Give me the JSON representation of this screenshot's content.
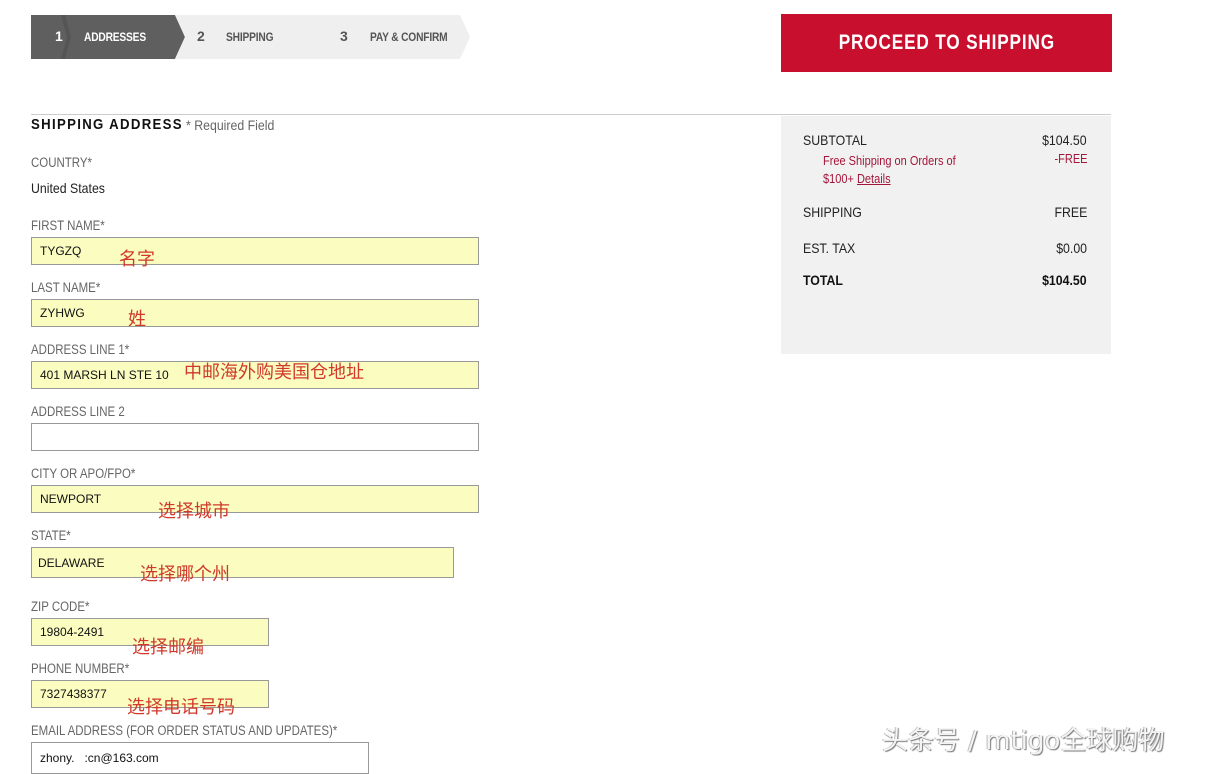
{
  "steps": [
    {
      "number": "1",
      "label": "ADDRESSES",
      "active": true
    },
    {
      "number": "2",
      "label": "SHIPPING",
      "active": false
    },
    {
      "number": "3",
      "label": "PAY & CONFIRM",
      "active": false
    }
  ],
  "proceed_button": {
    "label": "PROCEED TO SHIPPING"
  },
  "form": {
    "title": "SHIPPING ADDRESS",
    "required_note": "* Required Field",
    "country": {
      "label": "COUNTRY*",
      "value": "United States"
    },
    "first_name": {
      "label": "FIRST NAME*",
      "value": "TYGZQ",
      "annotation": "名字"
    },
    "last_name": {
      "label": "LAST NAME*",
      "value": "ZYHWG",
      "annotation": "姓"
    },
    "address1": {
      "label": "ADDRESS LINE 1*",
      "value": "401 MARSH LN STE 10",
      "annotation": "中邮海外购美国仓地址"
    },
    "address2": {
      "label": "ADDRESS LINE 2",
      "value": ""
    },
    "city": {
      "label": "CITY OR APO/FPO*",
      "value": "NEWPORT",
      "annotation": "选择城市"
    },
    "state": {
      "label": "STATE*",
      "value": "DELAWARE",
      "annotation": "选择哪个州"
    },
    "zip": {
      "label": "ZIP CODE*",
      "value": "19804-2491",
      "annotation": "选择邮编"
    },
    "phone": {
      "label": "PHONE NUMBER*",
      "value": "7327438377",
      "annotation": "选择电话号码"
    },
    "email": {
      "label": "EMAIL ADDRESS (FOR ORDER STATUS AND UPDATES)*",
      "value": "zhony.   :cn@163.com"
    }
  },
  "summary": {
    "subtotal": {
      "label": "SUBTOTAL",
      "value": "$104.50"
    },
    "promo": {
      "text": "Free Shipping on Orders of $100+",
      "link": "Details",
      "value": "-FREE"
    },
    "shipping": {
      "label": "SHIPPING",
      "value": "FREE"
    },
    "tax": {
      "label": "EST. TAX",
      "value": "$0.00"
    },
    "total": {
      "label": "TOTAL",
      "value": "$104.50"
    }
  },
  "watermark": "头条号 / mtigo全球购物",
  "colors": {
    "accent": "#c8102e",
    "active_step": "#5f5f5f",
    "inactive_step": "#eeeeee",
    "autofill": "#fafcc0",
    "promo": "#a3163a"
  }
}
